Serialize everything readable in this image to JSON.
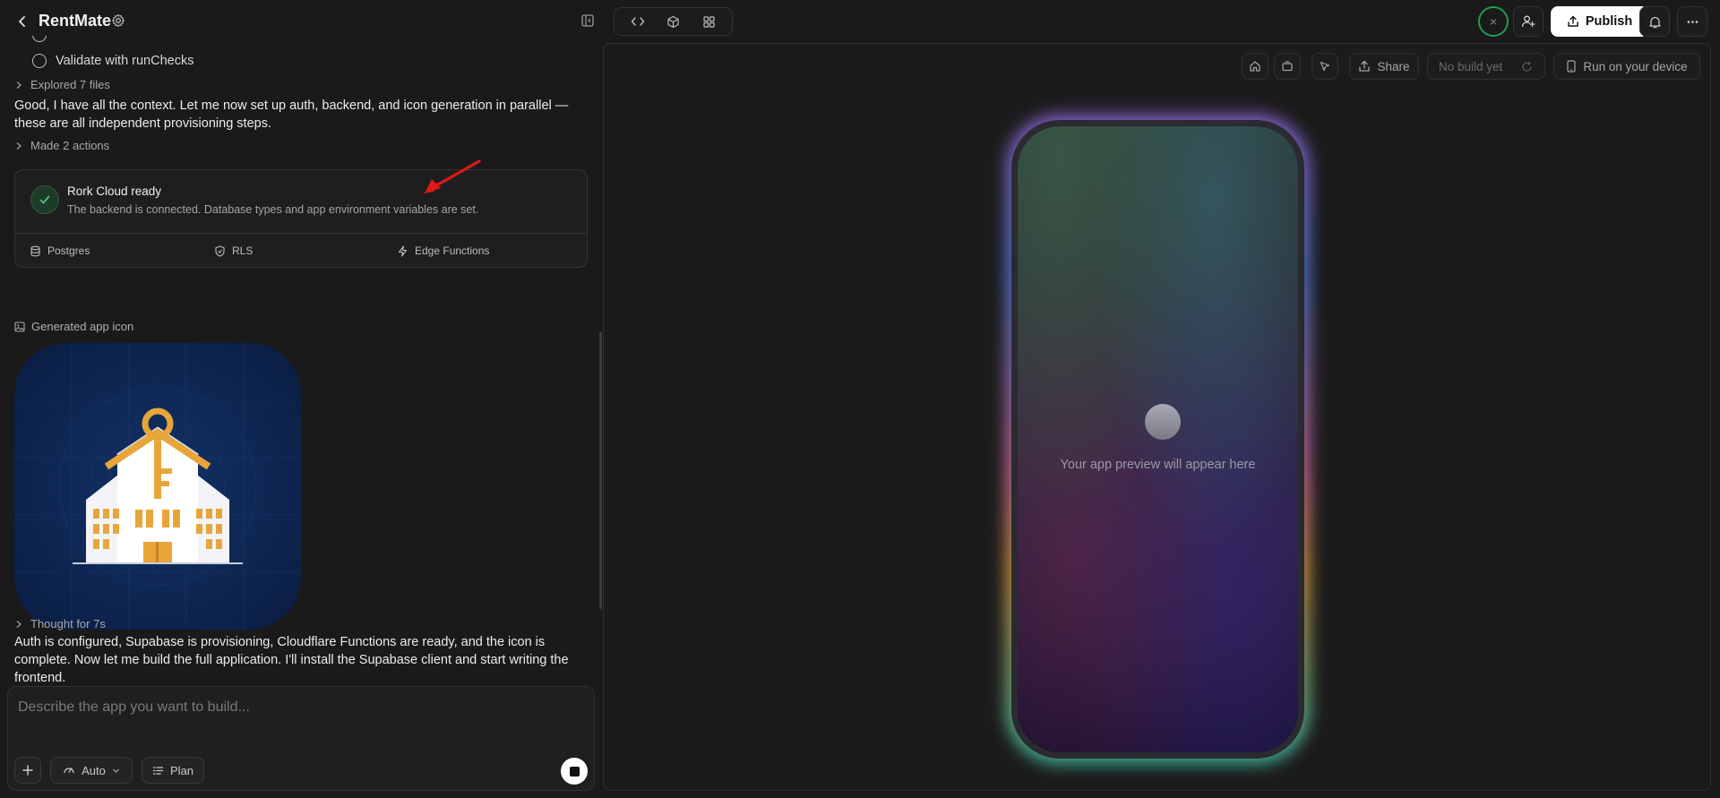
{
  "header": {
    "title": "RentMate"
  },
  "chat": {
    "todo_items": [
      {
        "label": "Validate with runChecks"
      }
    ],
    "explored": "Explored 7 files",
    "message_1": "Good, I have all the context. Let me now set up auth, backend, and icon generation in parallel — these are all independent provisioning steps.",
    "actions": "Made 2 actions",
    "cloud_card": {
      "title": "Rork Cloud ready",
      "subtitle": "The backend is connected. Database types and app environment variables are set.",
      "features": [
        {
          "label": "Postgres",
          "icon": "database-icon"
        },
        {
          "label": "RLS",
          "icon": "shield-check-icon"
        },
        {
          "label": "Edge Functions",
          "icon": "lightning-icon"
        }
      ]
    },
    "generated_icon_label": "Generated app icon",
    "thought": "Thought for 7s",
    "message_2": "Auth is configured, Supabase is provisioning, Cloudflare Functions are ready, and the icon is complete. Now let me build the full application. I'll install the Supabase client and start writing the frontend."
  },
  "composer": {
    "placeholder": "Describe the app you want to build...",
    "model_label": "Auto",
    "plan_label": "Plan"
  },
  "topbar": {
    "status_symbol": "×",
    "publish_label": "Publish"
  },
  "preview": {
    "share_label": "Share",
    "build_status": "No build yet",
    "run_device_label": "Run on your device",
    "placeholder_text": "Your app preview will appear here"
  },
  "colors": {
    "background": "#1a1a1a",
    "accent_green": "#1f9d55",
    "icon_navy": "#0d2450",
    "icon_gold": "#e8a63a"
  }
}
